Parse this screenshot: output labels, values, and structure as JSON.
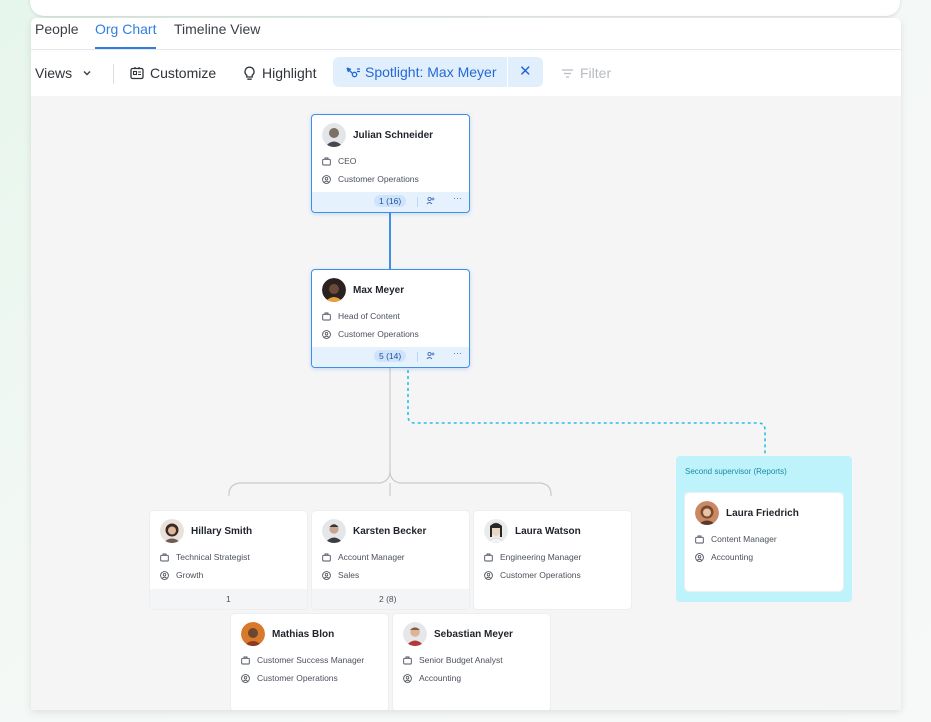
{
  "tabs": [
    {
      "label": "People",
      "active": false
    },
    {
      "label": "Org Chart",
      "active": true
    },
    {
      "label": "Timeline View",
      "active": false
    }
  ],
  "toolbar": {
    "views_label": "Views",
    "customize_label": "Customize",
    "highlight_label": "Highlight",
    "spotlight_label": "Spotlight: Max Meyer",
    "clear_symbol": "✕",
    "filter_label": "Filter"
  },
  "colors": {
    "accent": "#2f7fe0",
    "selected_border": "#3f8ee8",
    "dotted_link": "#26c2e6",
    "second_supervisor_bg": "#bff3fb"
  },
  "cards": {
    "julian": {
      "name": "Julian Schneider",
      "title": "CEO",
      "department": "Customer Operations",
      "reports": "1 (16)",
      "selected": true
    },
    "max": {
      "name": "Max Meyer",
      "title": "Head of Content",
      "department": "Customer Operations",
      "reports": "5 (14)",
      "selected": true
    },
    "hillary": {
      "name": "Hillary Smith",
      "title": "Technical Strategist",
      "department": "Growth",
      "reports": "1"
    },
    "karsten": {
      "name": "Karsten Becker",
      "title": "Account Manager",
      "department": "Sales",
      "reports": "2 (8)"
    },
    "laura_w": {
      "name": "Laura Watson",
      "title": "Engineering Manager",
      "department": "Customer Operations"
    },
    "mathias": {
      "name": "Mathias Blon",
      "title": "Customer Success Manager",
      "department": "Customer Operations"
    },
    "sebastian": {
      "name": "Sebastian Meyer",
      "title": "Senior Budget Analyst",
      "department": "Accounting"
    },
    "laura_f": {
      "name": "Laura Friedrich",
      "title": "Content Manager",
      "department": "Accounting"
    }
  },
  "second_supervisor": {
    "title": "Second supervisor (Reports)"
  },
  "icons": {
    "views": "chevron-down-icon",
    "customize": "id-card-icon",
    "highlight": "lightbulb-icon",
    "spotlight": "spotlight-icon",
    "filter": "filter-icon",
    "title_row": "briefcase-icon",
    "department_row": "user-circle-icon",
    "add_person": "add-person-icon",
    "more": "more-icon"
  }
}
